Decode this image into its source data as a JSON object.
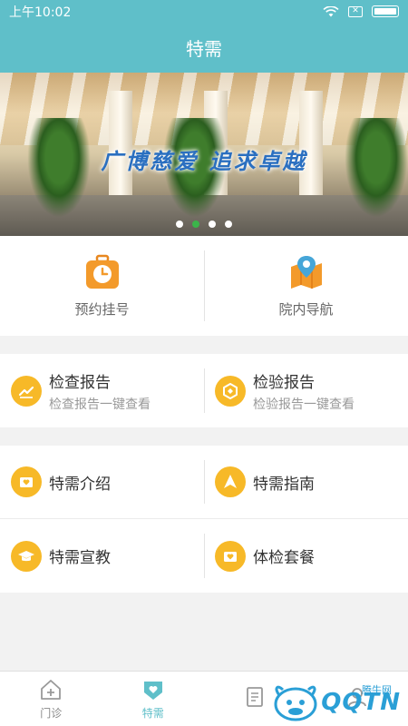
{
  "status_bar": {
    "time": "上午10:02"
  },
  "header": {
    "title": "特需"
  },
  "banner": {
    "slogan": "广博慈爱  追求卓越",
    "dot_count": 4,
    "active_dot": 1
  },
  "quick_actions": [
    {
      "label": "预约挂号",
      "icon": "alarm-clock-icon"
    },
    {
      "label": "院内导航",
      "icon": "map-pin-icon"
    }
  ],
  "reports": [
    {
      "title": "检查报告",
      "subtitle": "检查报告一键查看",
      "icon": "chart-icon"
    },
    {
      "title": "检验报告",
      "subtitle": "检验报告一键查看",
      "icon": "hexagon-icon"
    }
  ],
  "services": [
    {
      "title": "特需介绍",
      "icon": "heart-card-icon"
    },
    {
      "title": "特需指南",
      "icon": "navigation-arrow-icon"
    },
    {
      "title": "特需宣教",
      "icon": "graduation-cap-icon"
    },
    {
      "title": "体检套餐",
      "icon": "heart-card-icon"
    }
  ],
  "tabbar": {
    "tabs": [
      {
        "label": "门诊",
        "icon": "clinic-icon",
        "active": false
      },
      {
        "label": "特需",
        "icon": "heart-shield-icon",
        "active": true
      },
      {
        "label": "",
        "icon": "document-icon",
        "active": false
      },
      {
        "label": "",
        "icon": "user-icon",
        "active": false
      }
    ]
  },
  "watermark": {
    "brand": "QQTN",
    "caption": "腾牛网"
  },
  "colors": {
    "primary": "#5fbfc9",
    "accent": "#f7b928",
    "orange": "#f39a2b",
    "dot_active": "#3bb54a"
  }
}
